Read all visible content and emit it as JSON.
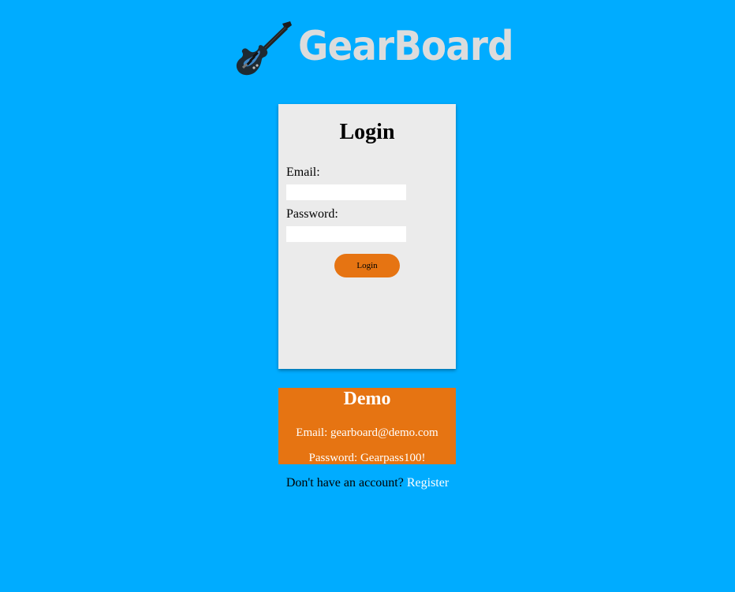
{
  "brand": {
    "name": "GearBoard",
    "logo_icon": "electric-guitar-icon"
  },
  "login": {
    "title": "Login",
    "email_label": "Email:",
    "email_value": "",
    "password_label": "Password:",
    "password_value": "",
    "submit_label": "Login"
  },
  "demo": {
    "title": "Demo",
    "email_line": "Email: gearboard@demo.com",
    "password_line": "Password: Gearpass100!"
  },
  "register": {
    "prompt": "Don't have an account?",
    "link_label": "Register"
  },
  "colors": {
    "background": "#00acff",
    "accent_orange": "#e67412",
    "card_gray": "#ebebeb",
    "logo_text": "#dcdcdc"
  }
}
